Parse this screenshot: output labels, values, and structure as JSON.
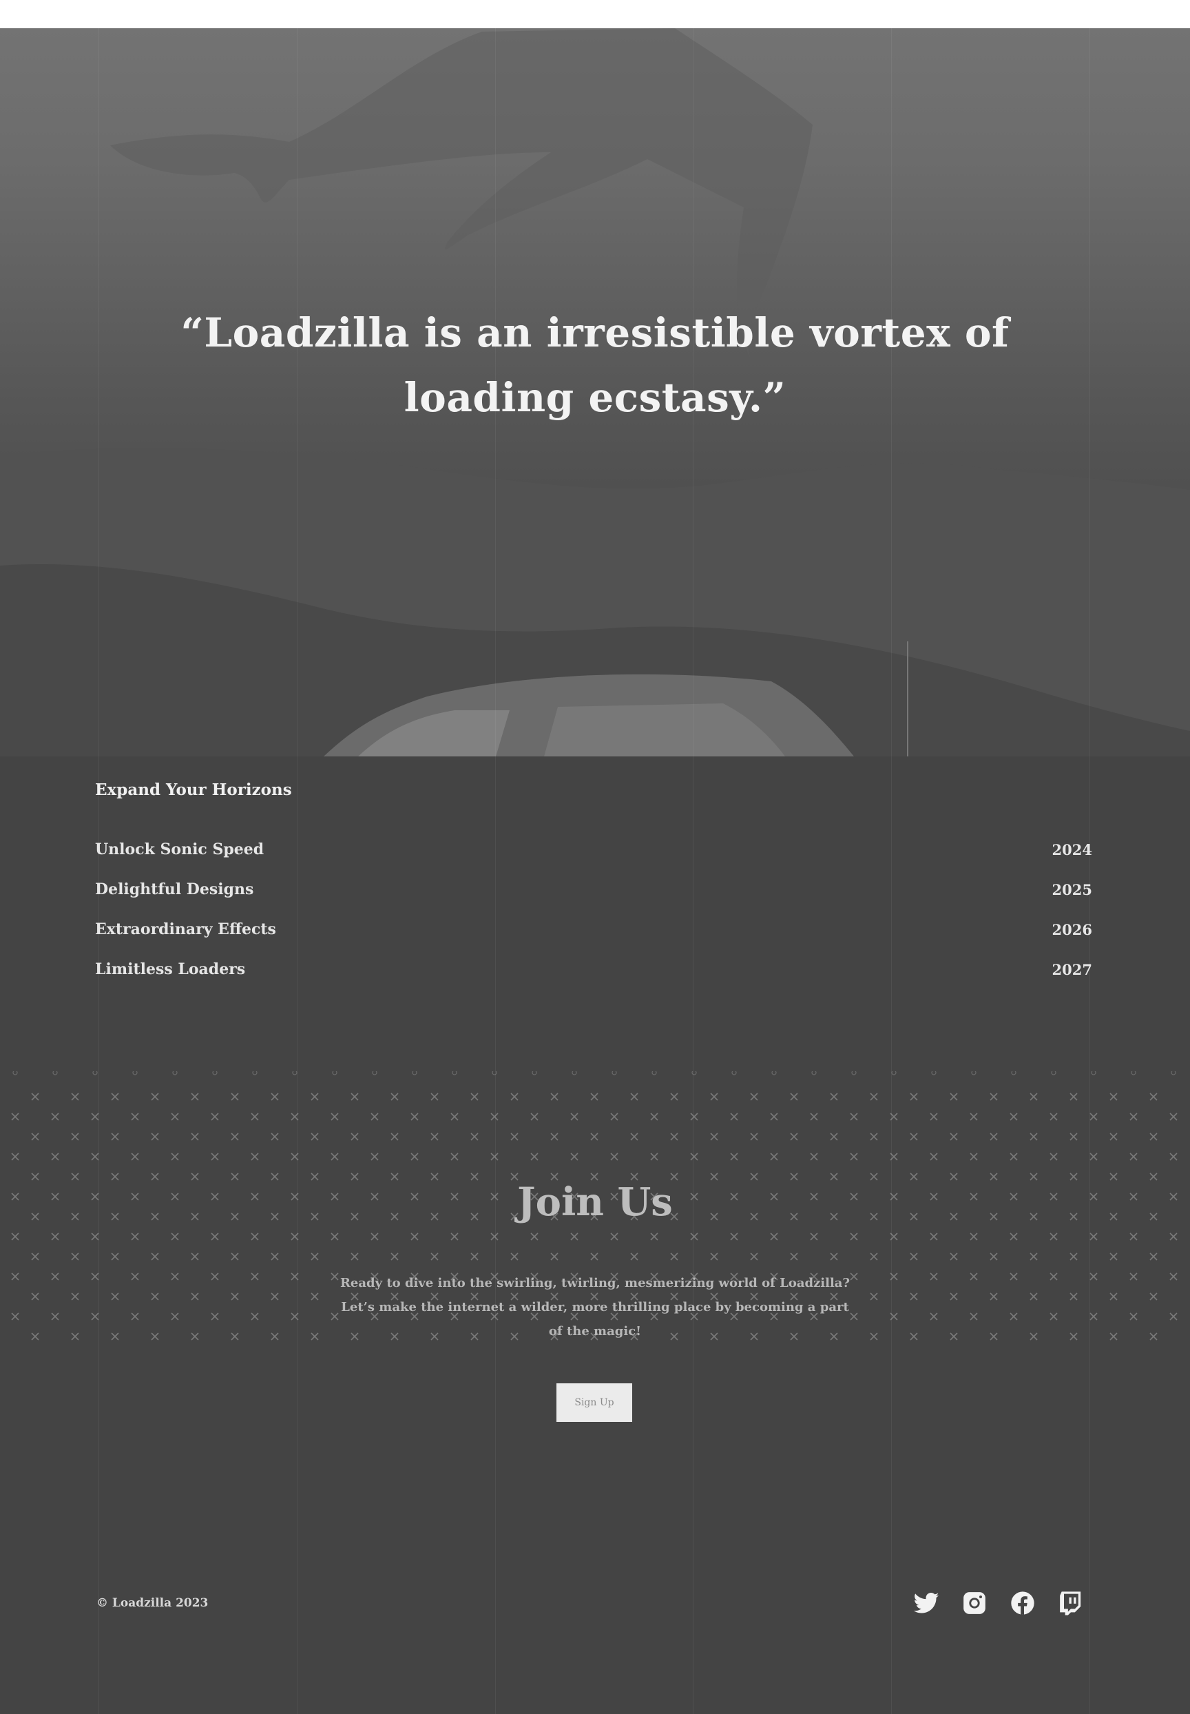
{
  "hero": {
    "quote": "“Loadzilla is an irresistible vortex of loading ecstasy.”"
  },
  "horizons": {
    "title": "Expand Your Horizons",
    "items": [
      {
        "label": "Unlock Sonic Speed",
        "year": "2024"
      },
      {
        "label": "Delightful Designs",
        "year": "2025"
      },
      {
        "label": "Extraordinary Effects",
        "year": "2026"
      },
      {
        "label": "Limitless Loaders",
        "year": "2027"
      }
    ]
  },
  "join": {
    "title": "Join Us",
    "text": "Ready to dive into the swirling, twirling, mesmerizing world of Loadzilla? Let’s make the internet a wilder, more thrilling place by becoming a part of the magic!",
    "button_label": "Sign Up"
  },
  "footer": {
    "copyright": "© Loadzilla 2023",
    "socials": [
      "twitter-icon",
      "instagram-icon",
      "facebook-icon",
      "twitch-icon"
    ]
  }
}
